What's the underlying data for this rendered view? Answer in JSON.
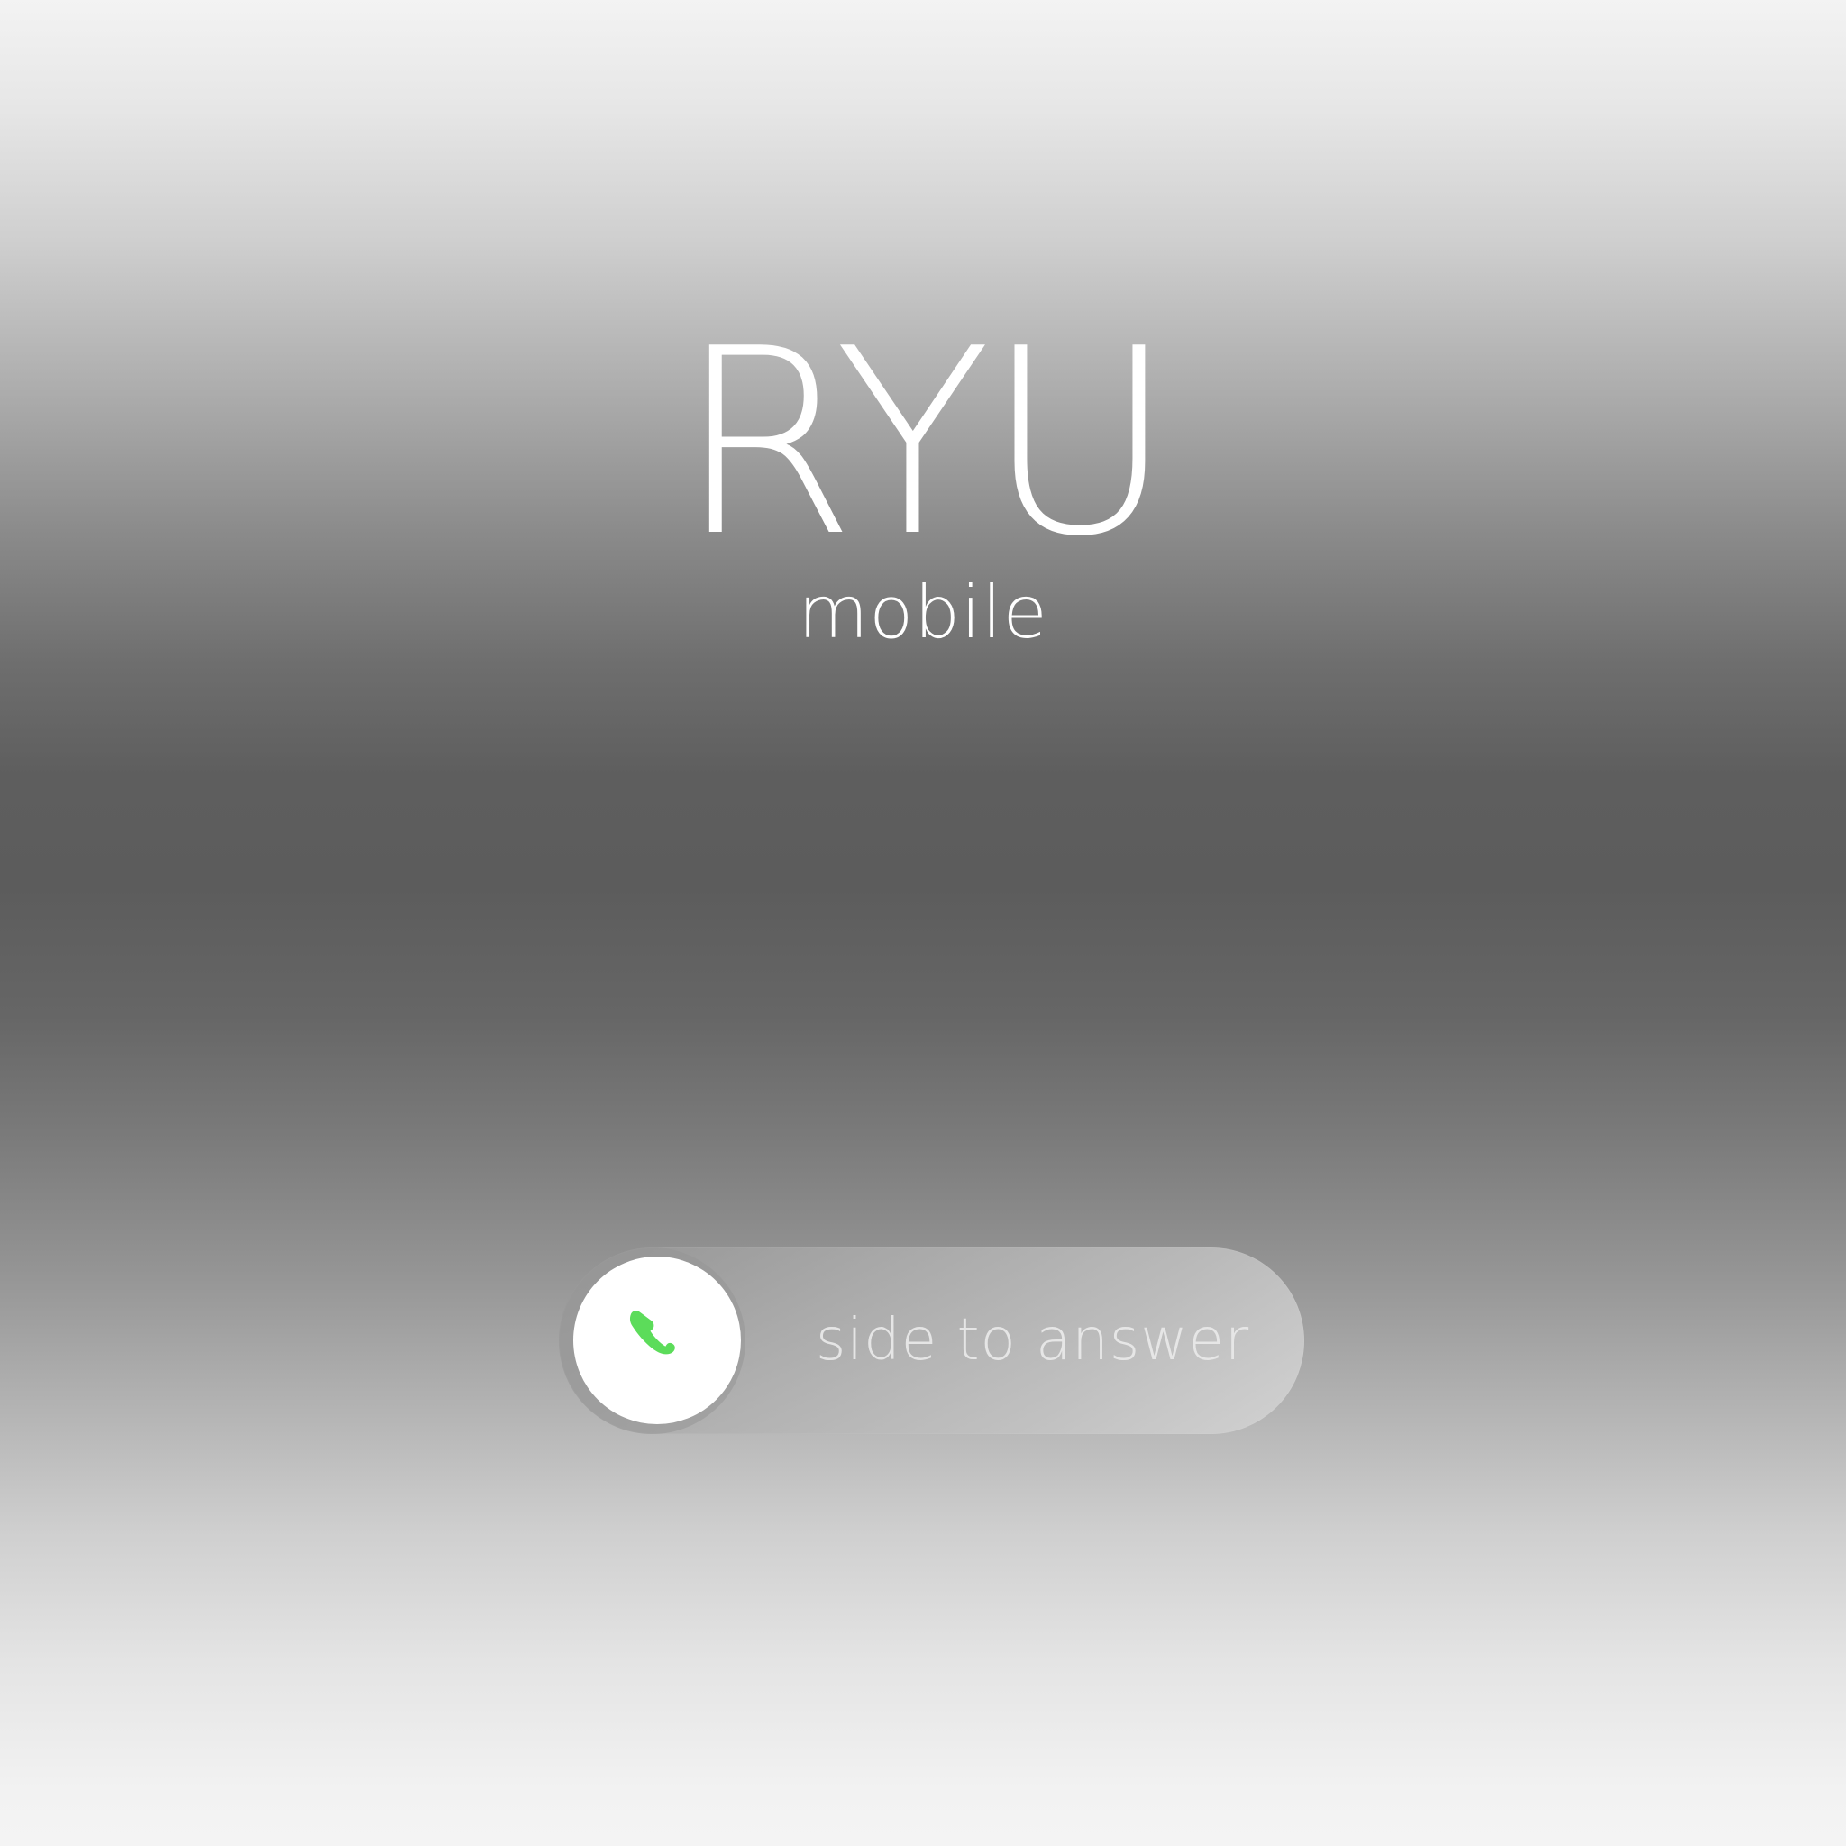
{
  "brand": {
    "title": "RYU",
    "subtitle": "mobile"
  },
  "call_slider": {
    "label": "side to answer",
    "icon": "phone-icon",
    "icon_color": "#5cdc5a"
  },
  "colors": {
    "text": "#ffffff",
    "knob": "#ffffff",
    "accent": "#5cdc5a"
  }
}
